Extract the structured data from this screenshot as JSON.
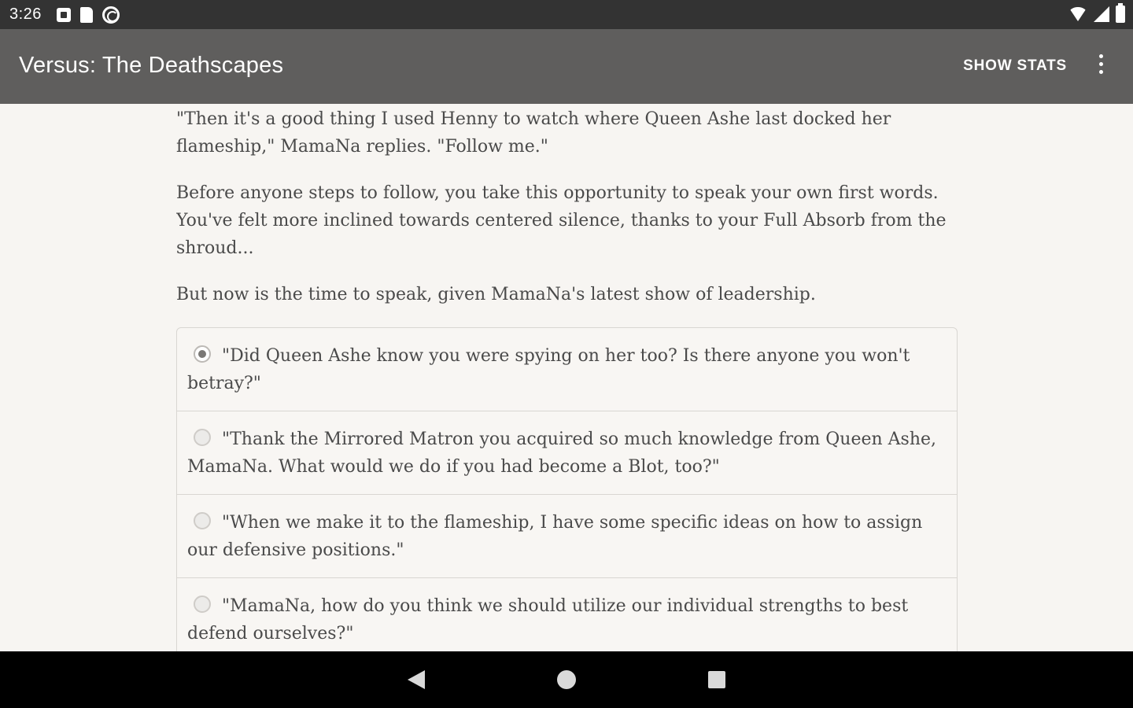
{
  "status_bar": {
    "time": "3:26",
    "icons_left": [
      "notification-square-icon",
      "sd-card-icon",
      "sync-circle-icon"
    ],
    "icons_right": [
      "wifi-icon",
      "cell-signal-icon",
      "battery-icon"
    ]
  },
  "app_bar": {
    "title": "Versus: The Deathscapes",
    "show_stats_label": "SHOW STATS",
    "overflow_icon": "more-vert-icon",
    "background": "#5f5e5d"
  },
  "story": {
    "paragraphs": [
      "\"Then it's a good thing I used Henny to watch where Queen Ashe last docked her flameship,\" MamaNa replies. \"Follow me.\"",
      "Before anyone steps to follow, you take this opportunity to speak your own first words. You've felt more inclined towards centered silence, thanks to your Full Absorb from the shroud...",
      "But now is the time to speak, given MamaNa's latest show of leadership."
    ]
  },
  "choices": [
    {
      "text": "\"Did Queen Ashe know you were spying on her too? Is there anyone you won't betray?\"",
      "selected": true
    },
    {
      "text": "\"Thank the Mirrored Matron you acquired so much knowledge from Queen Ashe, MamaNa. What would we do if you had become a Blot, too?\"",
      "selected": false
    },
    {
      "text": "\"When we make it to the flameship, I have some specific ideas on how to assign our defensive positions.\"",
      "selected": false
    },
    {
      "text": "\"MamaNa, how do you think we should utilize our individual strengths to best defend ourselves?\"",
      "selected": false
    }
  ],
  "nav_bar": {
    "icons": [
      "back-triangle-icon",
      "home-circle-icon",
      "recents-square-icon"
    ]
  }
}
